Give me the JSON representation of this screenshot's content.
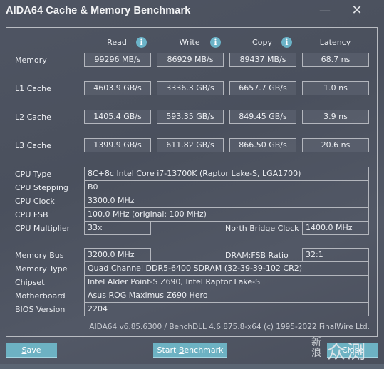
{
  "window": {
    "title": "AIDA64 Cache & Memory Benchmark",
    "minimize_glyph": "—",
    "close_glyph": "✕"
  },
  "benchmark": {
    "columns": [
      {
        "label": "Read",
        "info": true
      },
      {
        "label": "Write",
        "info": true
      },
      {
        "label": "Copy",
        "info": true
      },
      {
        "label": "Latency",
        "info": false
      }
    ],
    "info_glyph": "i",
    "rows": [
      {
        "label": "Memory",
        "read": "99296 MB/s",
        "write": "86929 MB/s",
        "copy": "89437 MB/s",
        "latency": "68.7 ns"
      },
      {
        "label": "L1 Cache",
        "read": "4603.9 GB/s",
        "write": "3336.3 GB/s",
        "copy": "6657.7 GB/s",
        "latency": "1.0 ns"
      },
      {
        "label": "L2 Cache",
        "read": "1405.4 GB/s",
        "write": "593.35 GB/s",
        "copy": "849.45 GB/s",
        "latency": "3.9 ns"
      },
      {
        "label": "L3 Cache",
        "read": "1399.9 GB/s",
        "write": "611.82 GB/s",
        "copy": "866.50 GB/s",
        "latency": "20.6 ns"
      }
    ]
  },
  "cpu": {
    "type_label": "CPU Type",
    "type_value": "8C+8c Intel Core i7-13700K  (Raptor Lake-S, LGA1700)",
    "stepping_label": "CPU Stepping",
    "stepping_value": "B0",
    "clock_label": "CPU Clock",
    "clock_value": "3300.0 MHz",
    "fsb_label": "CPU FSB",
    "fsb_value": "100.0 MHz  (original: 100 MHz)",
    "multiplier_label": "CPU Multiplier",
    "multiplier_value": "33x",
    "nb_clock_label": "North Bridge Clock",
    "nb_clock_value": "1400.0 MHz"
  },
  "memory": {
    "bus_label": "Memory Bus",
    "bus_value": "3200.0 MHz",
    "ratio_label": "DRAM:FSB Ratio",
    "ratio_value": "32:1",
    "type_label": "Memory Type",
    "type_value": "Quad Channel DDR5-6400 SDRAM  (32-39-39-102 CR2)",
    "chipset_label": "Chipset",
    "chipset_value": "Intel Alder Point-S Z690, Intel Raptor Lake-S",
    "motherboard_label": "Motherboard",
    "motherboard_value": "Asus ROG Maximus Z690 Hero",
    "bios_label": "BIOS Version",
    "bios_value": "2204"
  },
  "footer": {
    "version_text": "AIDA64 v6.85.6300 / BenchDLL 4.6.875.8-x64  (c) 1995-2022 FinalWire Ltd."
  },
  "buttons": {
    "save_mnemonic": "S",
    "save_rest": "ave",
    "start_prefix": "Start ",
    "start_mnemonic": "B",
    "start_rest": "enchmark",
    "close_label": "Close"
  },
  "watermark": {
    "small_top": "新",
    "small_bottom": "浪",
    "big": "众测"
  }
}
